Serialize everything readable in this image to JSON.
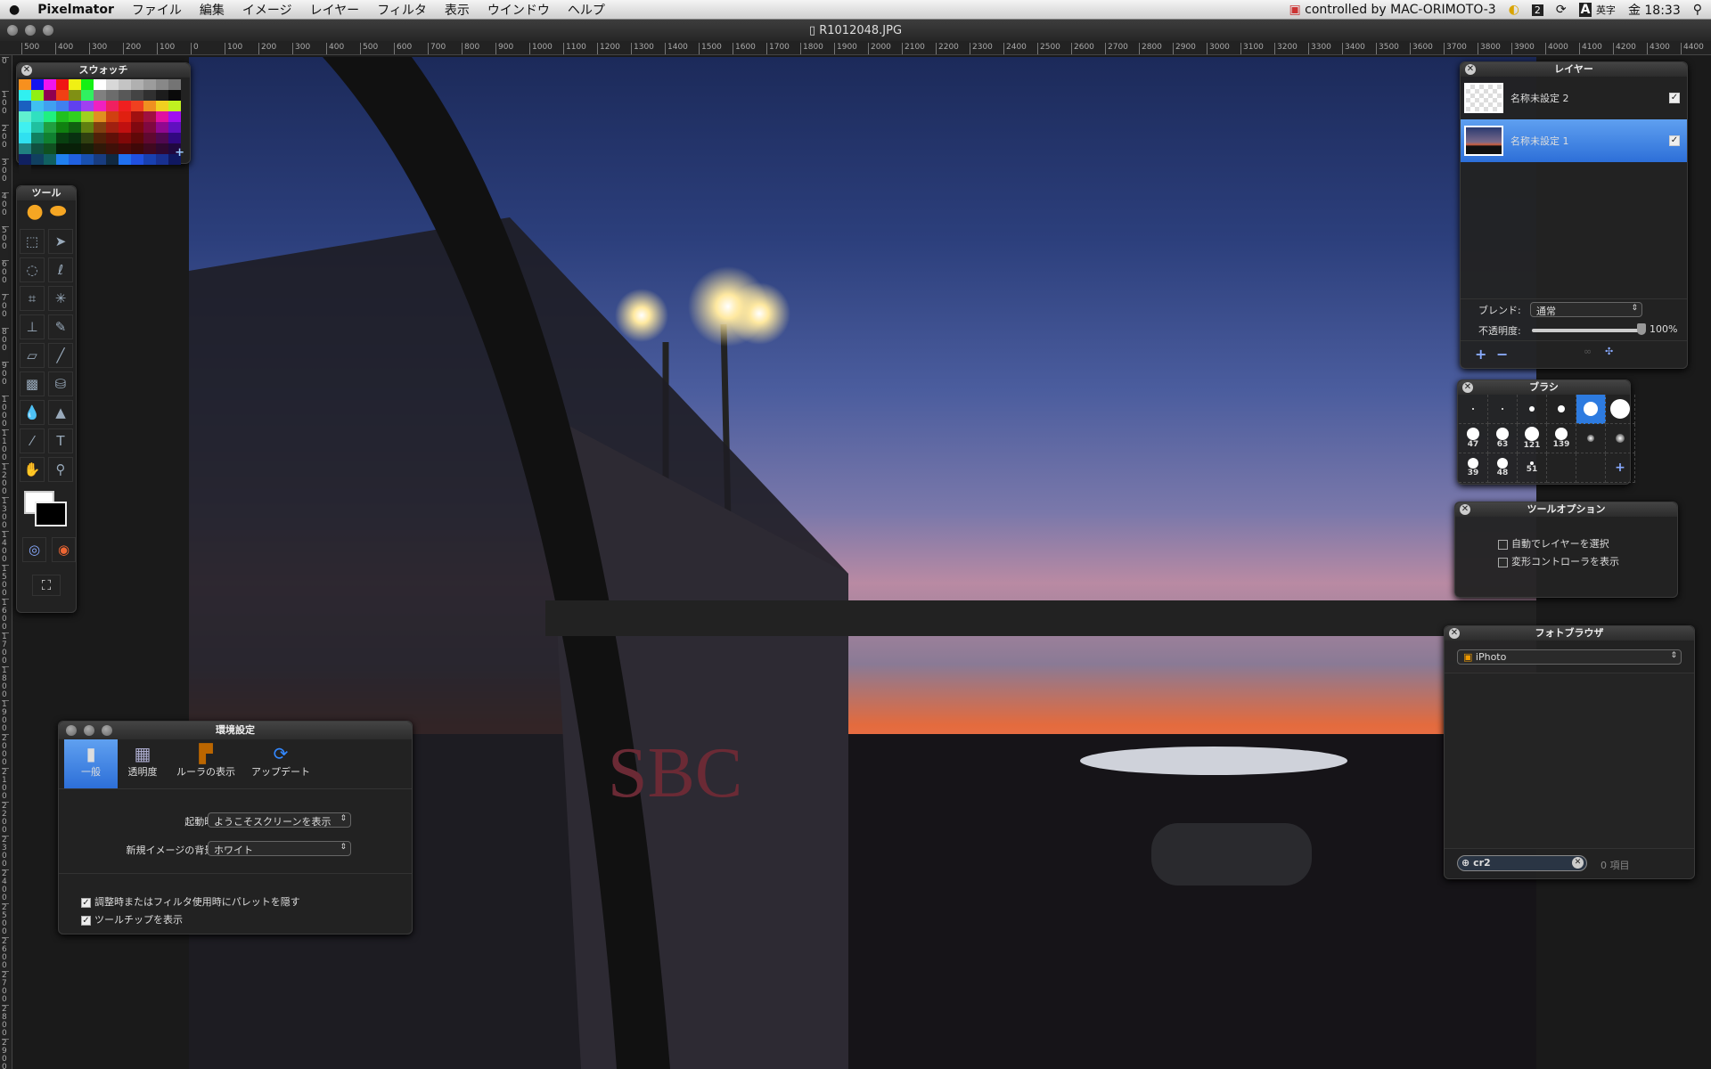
{
  "menubar": {
    "apple": "",
    "app": "Pixelmator",
    "items": [
      "ファイル",
      "編集",
      "イメージ",
      "レイヤー",
      "フィルタ",
      "表示",
      "ウインドウ",
      "ヘルプ"
    ],
    "status": "controlled by MAC-ORIMOTO-3",
    "space": "2",
    "input": "英字",
    "clock": "金 18:33"
  },
  "document": {
    "title": "R1012048.JPG"
  },
  "ruler": {
    "h": [
      "500",
      "400",
      "300",
      "200",
      "100",
      "0",
      "100",
      "200",
      "300",
      "400",
      "500",
      "600",
      "700",
      "800",
      "900",
      "1000",
      "1100",
      "1200",
      "1300",
      "1400",
      "1500",
      "1600",
      "1700",
      "1800",
      "1900",
      "2000",
      "2100",
      "2200",
      "2300",
      "2400",
      "2500",
      "2600",
      "2700",
      "2800",
      "2900",
      "3000",
      "3100",
      "3200",
      "3300",
      "3400",
      "3500",
      "3600",
      "3700",
      "3800",
      "3900",
      "4000",
      "4100",
      "4200",
      "4300",
      "4400"
    ],
    "v": [
      "0",
      "100",
      "200",
      "300",
      "400",
      "500",
      "600",
      "700",
      "800",
      "900",
      "1000",
      "1100",
      "1200",
      "1300",
      "1400",
      "1500",
      "1600",
      "1700",
      "1800",
      "1900",
      "2000",
      "2100",
      "2200",
      "2300",
      "2400",
      "2500",
      "2600",
      "2700",
      "2800",
      "2900"
    ]
  },
  "swatches": {
    "title": "スウォッチ",
    "colors": [
      "#f7901e",
      "#1414f0",
      "#f014f0",
      "#f01414",
      "#f0f014",
      "#14f014",
      "#ffffff",
      "#d8d8d8",
      "#c4c4c4",
      "#b0b0b0",
      "#9c9c9c",
      "#888888",
      "#747474",
      "#30f0f0",
      "#90f014",
      "#900050",
      "#f04014",
      "#809014",
      "#30f060",
      "#808080",
      "#6c6c6c",
      "#585858",
      "#444444",
      "#303030",
      "#1c1c1c",
      "#0a0a0a",
      "#1a60c0",
      "#40c0f0",
      "#40a0f0",
      "#4080f0",
      "#6040f0",
      "#a040f0",
      "#f020c0",
      "#f02060",
      "#f02020",
      "#f04020",
      "#f09020",
      "#f0d020",
      "#c0f020",
      "#60f0d0",
      "#30e0c0",
      "#20f080",
      "#20c020",
      "#30d020",
      "#a0d020",
      "#e09020",
      "#d04010",
      "#e02010",
      "#a01010",
      "#a01040",
      "#e010a0",
      "#a010f0",
      "#40f0f0",
      "#20c0a0",
      "#20a040",
      "#108010",
      "#106010",
      "#608010",
      "#804010",
      "#a02010",
      "#c01010",
      "#800810",
      "#800840",
      "#900890",
      "#6010c0",
      "#30e0f0",
      "#108060",
      "#108030",
      "#084010",
      "#083010",
      "#304010",
      "#502008",
      "#601008",
      "#800808",
      "#600808",
      "#600830",
      "#500850",
      "#300880",
      "#208080",
      "#105040",
      "#105020",
      "#082008",
      "#082008",
      "#182008",
      "#301808",
      "#401008",
      "#500808",
      "#400808",
      "#400820",
      "#300830",
      "#200840",
      "#102060",
      "#104060",
      "#106060",
      "#2080f0",
      "#2060e0",
      "#1850b0",
      "#183c80",
      "#102840",
      "#2070f0",
      "#2050e0",
      "#1840b0",
      "#183090",
      "#101860",
      "#1a1a1a"
    ],
    "add": "+"
  },
  "tools": {
    "title": "ツール",
    "items": [
      "marquee-rect",
      "move",
      "marquee-ellipse",
      "lasso",
      "crop",
      "magic-wand",
      "clone-stamp",
      "pencil",
      "eraser",
      "brush",
      "gradient",
      "paint-bucket",
      "blur",
      "sharpen",
      "eyedropper",
      "type",
      "hand",
      "zoom",
      "mask-quick",
      "mask-color"
    ]
  },
  "layers": {
    "title": "レイヤー",
    "items": [
      {
        "name": "名称未設定 2",
        "visible": true,
        "selected": false
      },
      {
        "name": "名称未設定 1",
        "visible": true,
        "selected": true
      }
    ],
    "blend_label": "ブレンド:",
    "blend_value": "通常",
    "opacity_label": "不透明度:",
    "opacity_value": "100%",
    "opacity": 1.0
  },
  "brushes": {
    "title": "ブラシ",
    "sizes": [
      "",
      "",
      "",
      "",
      "",
      "",
      "47",
      "63",
      "121",
      "139",
      "",
      "",
      "39",
      "48",
      "51",
      "",
      "",
      ""
    ],
    "add": "+"
  },
  "tool_options": {
    "title": "ツールオプション",
    "auto_select": "自動でレイヤーを選択",
    "show_transform": "変形コントローラを表示"
  },
  "photo_browser": {
    "title": "フォトブラウザ",
    "source": "iPhoto",
    "search_value": "cr2",
    "count": "0 項目"
  },
  "preferences": {
    "title": "環境設定",
    "tabs": [
      "一般",
      "透明度",
      "ルーラの表示",
      "アップデート"
    ],
    "startup_label": "起動時:",
    "startup_value": "ようこそスクリーンを表示",
    "bg_label": "新規イメージの背景:",
    "bg_value": "ホワイト",
    "hide_palettes": "調整時またはフィルタ使用時にパレットを隠す",
    "show_tooltips": "ツールチップを表示"
  },
  "canvas": {
    "sign": "SBC"
  }
}
